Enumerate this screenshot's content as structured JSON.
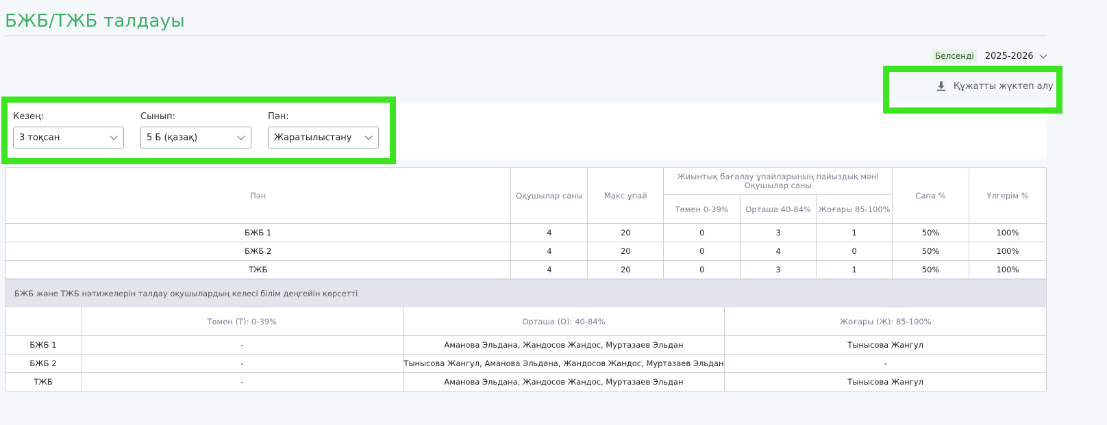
{
  "page": {
    "title": "БЖБ/ТЖБ талдауы"
  },
  "year": {
    "active_label": "Белсенді",
    "value": "2025-2026"
  },
  "download": {
    "label": "Құжатты жүктеп алу",
    "icon": "download-icon"
  },
  "filters": [
    {
      "label": "Кезең:",
      "value": "3 тоқсан"
    },
    {
      "label": "Сынып:",
      "value": "5 Б (қазақ)"
    },
    {
      "label": "Пән:",
      "value": "Жаратылыстану"
    }
  ],
  "summary_table": {
    "headers": {
      "subject": "Пән",
      "students": "Оқушылар саны",
      "max_score": "Макс ұпай",
      "group_line1": "Жиынтық бағалау ұпайларының пайыздық мәні",
      "group_line2": "Оқушылар саны",
      "low": "Төмен 0-39%",
      "mid": "Орташа 40-84%",
      "high": "Жоғары 85-100%",
      "quality": "Сапа %",
      "success": "Үлгерім %"
    },
    "rows": [
      {
        "subject": "БЖБ 1",
        "students": "4",
        "max": "20",
        "low": "0",
        "mid": "3",
        "high": "1",
        "quality": "50%",
        "success": "100%"
      },
      {
        "subject": "БЖБ 2",
        "students": "4",
        "max": "20",
        "low": "0",
        "mid": "4",
        "high": "0",
        "quality": "50%",
        "success": "100%"
      },
      {
        "subject": "ТЖБ",
        "students": "4",
        "max": "20",
        "low": "0",
        "mid": "3",
        "high": "1",
        "quality": "50%",
        "success": "100%"
      }
    ]
  },
  "levels_table": {
    "caption": "БЖБ және ТЖБ нәтижелерін талдау оқушылардың келесі білім деңгейін көрсетті",
    "headers": {
      "low": "Төмен (Т): 0-39%",
      "mid": "Орташа (О): 40-84%",
      "high": "Жоғары (Ж): 85-100%"
    },
    "rows": [
      {
        "name": "БЖБ 1",
        "low": "-",
        "mid": "Аманова Эльдана, Жандосов Жандос, Муртазаев Эльдан",
        "high": "Тынысова Жангул"
      },
      {
        "name": "БЖБ 2",
        "low": "-",
        "mid": "Тынысова Жангул, Аманова Эльдана, Жандосов Жандос, Муртазаев Эльдан",
        "high": "-"
      },
      {
        "name": "ТЖБ",
        "low": "-",
        "mid": "Аманова Эльдана, Жандосов Жандос, Муртазаев Эльдан",
        "high": "Тынысова Жангул"
      }
    ]
  },
  "colors": {
    "accent": "#3fb06a",
    "highlight": "#3de41f"
  }
}
